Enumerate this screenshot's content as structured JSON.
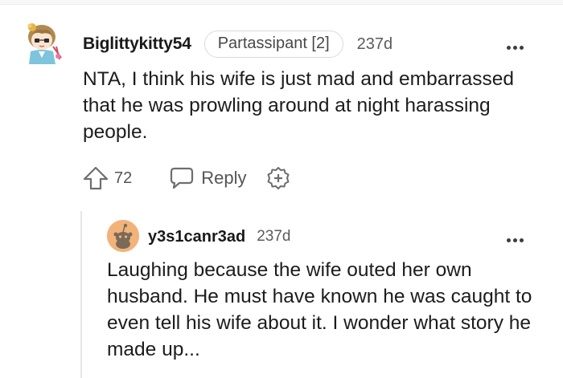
{
  "comment": {
    "username": "Biglittykitty54",
    "flair": "Partassipant [2]",
    "age": "237d",
    "body": "NTA, I think his wife is just mad and embarrassed that he was prowling around at night harassing people.",
    "votes": "72",
    "reply_label": "Reply",
    "icons": [
      "upvote-icon",
      "reply-bubble-icon",
      "award-plus-icon",
      "more-options-icon"
    ]
  },
  "reply": {
    "username": "y3s1canr3ad",
    "age": "237d",
    "body": "Laughing because the wife outed her own husband. He must have known he was caught to even tell his wife about it. I wonder what story he made up..."
  },
  "colors": {
    "text": "#1c1c1c",
    "muted": "#595b5d",
    "reply_avatar": "#f2b37a",
    "thread_line": "#e3e5e8"
  }
}
